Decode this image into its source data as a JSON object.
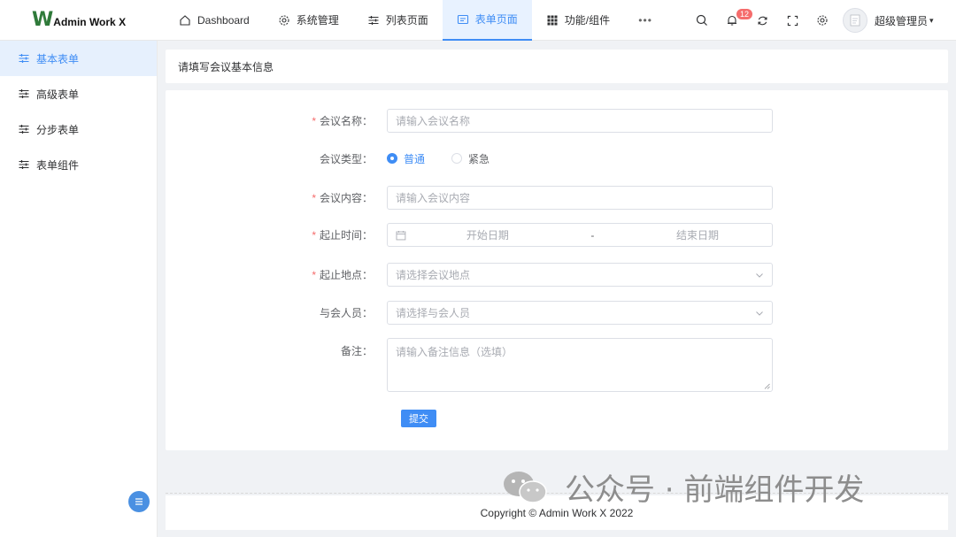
{
  "app": {
    "logo_mark": "W",
    "logo_text": "Admin Work X"
  },
  "nav": {
    "items": [
      {
        "label": "Dashboard",
        "icon": "home-icon"
      },
      {
        "label": "系统管理",
        "icon": "gear-icon"
      },
      {
        "label": "列表页面",
        "icon": "sliders-icon"
      },
      {
        "label": "表单页面",
        "icon": "form-icon",
        "active": true
      },
      {
        "label": "功能/组件",
        "icon": "grid-icon"
      }
    ],
    "more": "•••"
  },
  "toolbar": {
    "notification_count": "12"
  },
  "user": {
    "name": "超级管理员",
    "caret": "▾"
  },
  "sidebar": {
    "items": [
      {
        "label": "基本表单",
        "active": true
      },
      {
        "label": "高级表单"
      },
      {
        "label": "分步表单"
      },
      {
        "label": "表单组件"
      }
    ]
  },
  "page": {
    "card_title": "请填写会议基本信息"
  },
  "form": {
    "name": {
      "label": "会议名称：",
      "placeholder": "请输入会议名称"
    },
    "type": {
      "label": "会议类型：",
      "options": [
        "普通",
        "紧急"
      ],
      "selected": "普通"
    },
    "content": {
      "label": "会议内容：",
      "placeholder": "请输入会议内容"
    },
    "time": {
      "label": "起止时间：",
      "start_placeholder": "开始日期",
      "separator": "-",
      "end_placeholder": "结束日期"
    },
    "place": {
      "label": "起止地点：",
      "placeholder": "请选择会议地点"
    },
    "members": {
      "label": "与会人员：",
      "placeholder": "请选择与会人员"
    },
    "remark": {
      "label": "备注：",
      "placeholder": "请输入备注信息（选填）"
    },
    "required_mark": "*",
    "submit_label": "提交"
  },
  "watermark": {
    "text": "公众号 · 前端组件开发"
  },
  "footer": {
    "copyright": "Copyright © Admin Work X 2022"
  },
  "colors": {
    "primary": "#3f8df5",
    "required": "#f56c6c",
    "logo_green": "#2f7a3a"
  }
}
